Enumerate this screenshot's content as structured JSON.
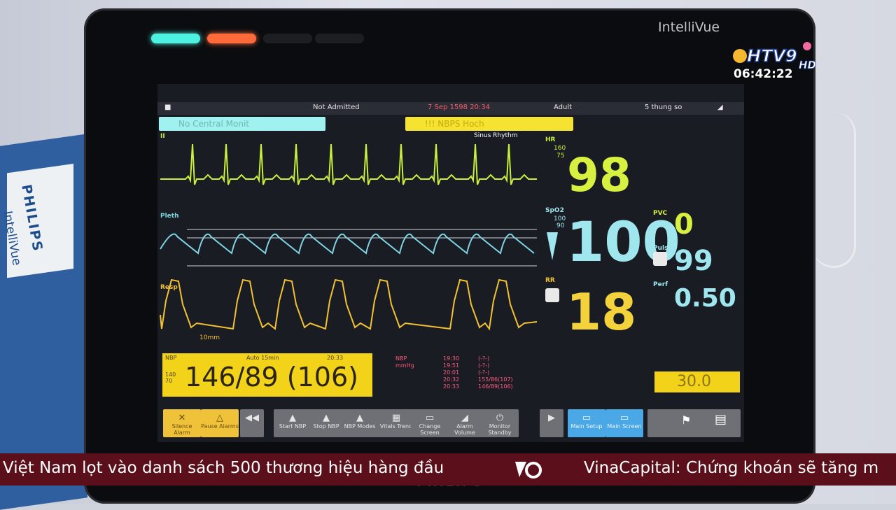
{
  "monitor": {
    "brand": "IntelliVue",
    "manufacturer": "PHILIPS",
    "box_brand": "PHILIPS",
    "box_product": "IntelliVue"
  },
  "status_bar": {
    "patient": "Not Admitted",
    "datetime": "7 Sep 1598 20:34",
    "category": "Adult",
    "volume_label": "5 thung so"
  },
  "alarms": {
    "left": "No Central Monit",
    "right": "!!! NBPS Hoch"
  },
  "rhythm_label": "Sinus Rhythm",
  "waves": {
    "ecg_label": "II",
    "pleth_label": "Pleth",
    "resp_label": "Resp",
    "resp_scale": "10mm"
  },
  "vitals": {
    "hr_label": "HR",
    "hr_limit_hi": "160",
    "hr_limit_lo": "75",
    "hr": "98",
    "spo2_label": "SpO2",
    "spo2_limit_hi": "100",
    "spo2_limit_lo": "90",
    "spo2": "100",
    "rr_label": "RR",
    "rr": "18",
    "pvc_label": "PVC",
    "pvc": "0",
    "pulse_label": "Pulse",
    "pulse": "99",
    "perf_label": "Perf",
    "perf": "0.50",
    "etco2": "30.0"
  },
  "nbp": {
    "value": "146/89 (106)",
    "header_left": "NBP",
    "header_mid": "Auto 15min",
    "header_right": "20:33",
    "limits": "140 70",
    "trend_label": "NBP",
    "trend_unit": "mmHg",
    "trend_times": [
      "19:30",
      "19:51",
      "20:01",
      "20:32",
      "20:33"
    ],
    "trend_values": [
      "(-?-)",
      "(-?-)",
      "(-?-)",
      "155/86(107)",
      "146/89(106)"
    ]
  },
  "footer_buttons": [
    {
      "icon": "✕",
      "label": "Silence Alarm"
    },
    {
      "icon": "△",
      "label": "Pause Alarms"
    },
    {
      "icon": "◀◀",
      "label": ""
    },
    {
      "icon": "▲",
      "label": "Start NBP"
    },
    {
      "icon": "▲",
      "label": "Stop NBP"
    },
    {
      "icon": "▲",
      "label": "NBP Modes"
    },
    {
      "icon": "▦",
      "label": "Vitals Trend"
    },
    {
      "icon": "▭",
      "label": "Change Screen"
    },
    {
      "icon": "◢",
      "label": "Alarm Volume"
    },
    {
      "icon": "⏻",
      "label": "Monitor Standby"
    },
    {
      "icon": "▶",
      "label": ""
    },
    {
      "icon": "▭",
      "label": "Main Setup"
    },
    {
      "icon": "▭",
      "label": "Main Screen"
    }
  ],
  "broadcast": {
    "channel": "HTV9",
    "hd": "HD",
    "time": "06:42:22",
    "ticker_left": "Việt Nam lọt vào danh sách 500 thương hiệu hàng đầu",
    "ticker_right": "VinaCapital: Chứng khoán sẽ tăng m"
  },
  "colors": {
    "ecg": "#c8f03c",
    "pleth": "#7fd6e3",
    "resp": "#f2c233",
    "hr": "#d8f040",
    "spo2": "#9fe6ee",
    "rr": "#f4d23b",
    "nbp_bg": "#f3d21a",
    "alarm_cyan": "#9ff2f0",
    "alarm_yellow": "#f5e231",
    "ticker_bg": "#5a0f1b"
  }
}
